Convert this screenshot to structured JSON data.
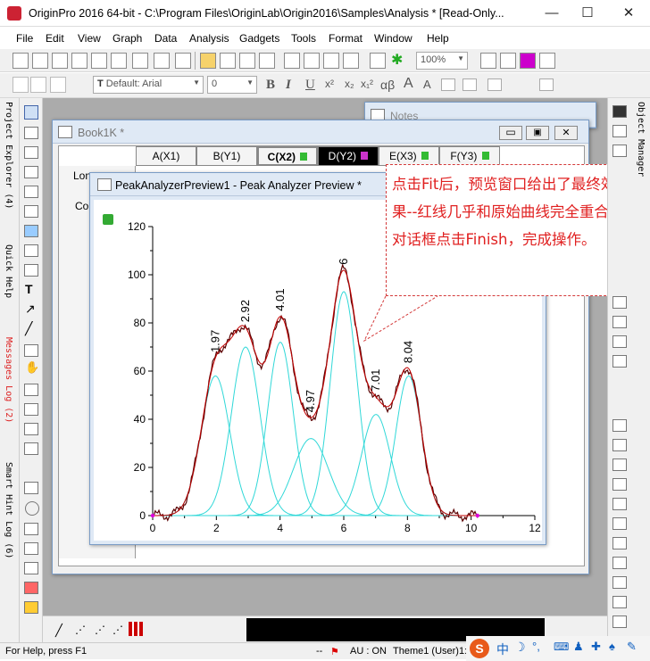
{
  "window": {
    "title": "OriginPro 2016 64-bit - C:\\Program Files\\OriginLab\\Origin2016\\Samples\\Analysis * [Read-Only..."
  },
  "menu": [
    "File",
    "Edit",
    "View",
    "Graph",
    "Data",
    "Analysis",
    "Gadgets",
    "Tools",
    "Format",
    "Window",
    "Help"
  ],
  "toolbar": {
    "zoom": "100%",
    "font": "Default: Arial",
    "font_size": "0",
    "bold": "B",
    "italic": "I",
    "underline": "U",
    "superscript": "x²",
    "subscript": "x₂",
    "supersub": "x₁²",
    "greek": "αβ",
    "increase_font": "A",
    "decrease_font": "A"
  },
  "side_panels": {
    "left": [
      "Project Explorer (4)",
      "Quick Help",
      "Messages Log (2)",
      "Smart Hint Log (6)"
    ],
    "right": [
      "Object Manager"
    ]
  },
  "notes_window": {
    "title": "Notes"
  },
  "book_window": {
    "title": "Book1K *",
    "columns": [
      "A(X1)",
      "B(Y1)",
      "C(X2)",
      "D(Y2)",
      "E(X3)",
      "F(Y3)"
    ],
    "row_labels": [
      "Lon",
      "Co"
    ]
  },
  "preview_window": {
    "title": "PeakAnalyzerPreview1 - Peak Analyzer Preview *"
  },
  "callout": {
    "text": "点击Fit后，预览窗口给出了最终效果--红线几乎和原始曲线完全重合。对话框点击Finish，完成操作。"
  },
  "status": {
    "help": "For Help, press F1",
    "dashes": "--",
    "au": "AU : ON",
    "theme": "Theme1 (User)",
    "extra": "1:",
    "ime_label": "中"
  },
  "colors": {
    "fit_line": "#c00000",
    "data_line": "#5a0000",
    "peak_lines": "#30d8d8",
    "callout_border": "#d43a3a",
    "callout_text": "#e02020"
  },
  "chart_data": {
    "type": "line",
    "xlim": [
      0,
      12
    ],
    "ylim": [
      0,
      120
    ],
    "x_ticks": [
      0,
      2,
      4,
      6,
      8,
      10,
      12
    ],
    "y_ticks": [
      0,
      20,
      40,
      60,
      80,
      100,
      120
    ],
    "peaks": [
      {
        "label": "1.97",
        "center": 1.97,
        "height": 58,
        "width": 0.45
      },
      {
        "label": "2.92",
        "center": 2.92,
        "height": 70,
        "width": 0.45
      },
      {
        "label": "4.01",
        "center": 4.01,
        "height": 72,
        "width": 0.4
      },
      {
        "label": "4.97",
        "center": 4.97,
        "height": 32,
        "width": 0.55
      },
      {
        "label": "6",
        "center": 6.0,
        "height": 93,
        "width": 0.42
      },
      {
        "label": "7.01",
        "center": 7.01,
        "height": 42,
        "width": 0.45
      },
      {
        "label": "8.04",
        "center": 8.04,
        "height": 58,
        "width": 0.4
      }
    ],
    "series": [
      {
        "role": "data"
      },
      {
        "role": "cumulative fit"
      },
      {
        "role": "fitted peaks"
      }
    ]
  }
}
